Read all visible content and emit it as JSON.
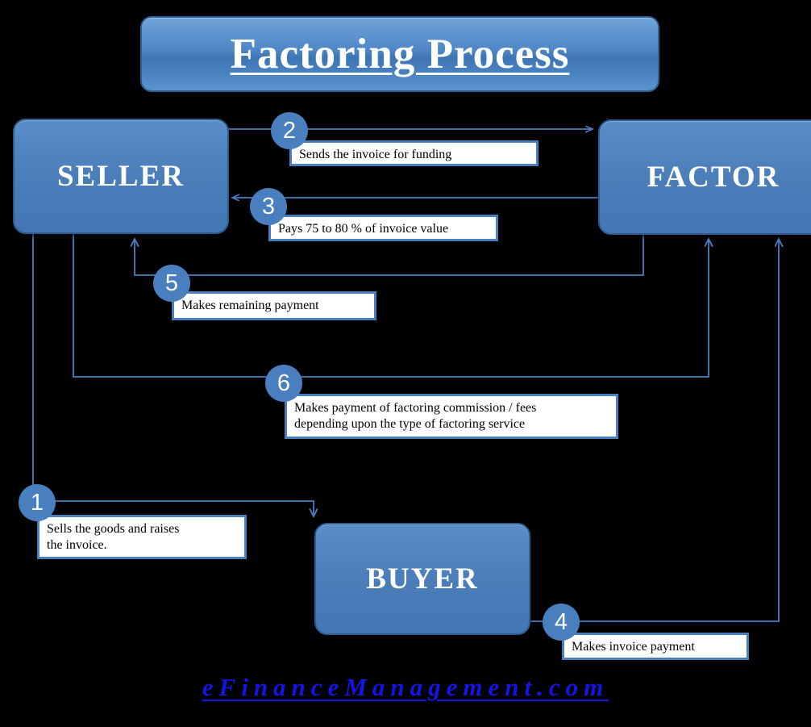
{
  "title": "Factoring Process",
  "theme": {
    "background": "#000000",
    "entity_fill": "#4a7cb8",
    "entity_border": "#2d5b92",
    "circle_fill": "#4a7fbf",
    "caption_border": "#4a7fbf",
    "caption_fill": "#ffffff",
    "line_color": "#4a7fbf",
    "title_text": "#ffffff",
    "footer_text": "#1414e6"
  },
  "entities": [
    {
      "id": "seller",
      "label": "SELLER"
    },
    {
      "id": "factor",
      "label": "FACTOR"
    },
    {
      "id": "buyer",
      "label": "BUYER"
    }
  ],
  "steps": [
    {
      "number": "1",
      "from": "seller",
      "to": "buyer",
      "caption": "Sells the goods and raises\nthe invoice."
    },
    {
      "number": "2",
      "from": "seller",
      "to": "factor",
      "caption": "Sends the invoice for funding"
    },
    {
      "number": "3",
      "from": "factor",
      "to": "seller",
      "caption": "Pays 75 to 80 % of invoice value"
    },
    {
      "number": "4",
      "from": "buyer",
      "to": "factor",
      "caption": "Makes invoice payment"
    },
    {
      "number": "5",
      "from": "factor",
      "to": "seller",
      "caption": "Makes remaining payment"
    },
    {
      "number": "6",
      "from": "seller",
      "to": "factor",
      "caption": "Makes payment of factoring commission /  fees\ndepending upon the type of factoring service"
    }
  ],
  "footer": "eFinanceManagement.com"
}
